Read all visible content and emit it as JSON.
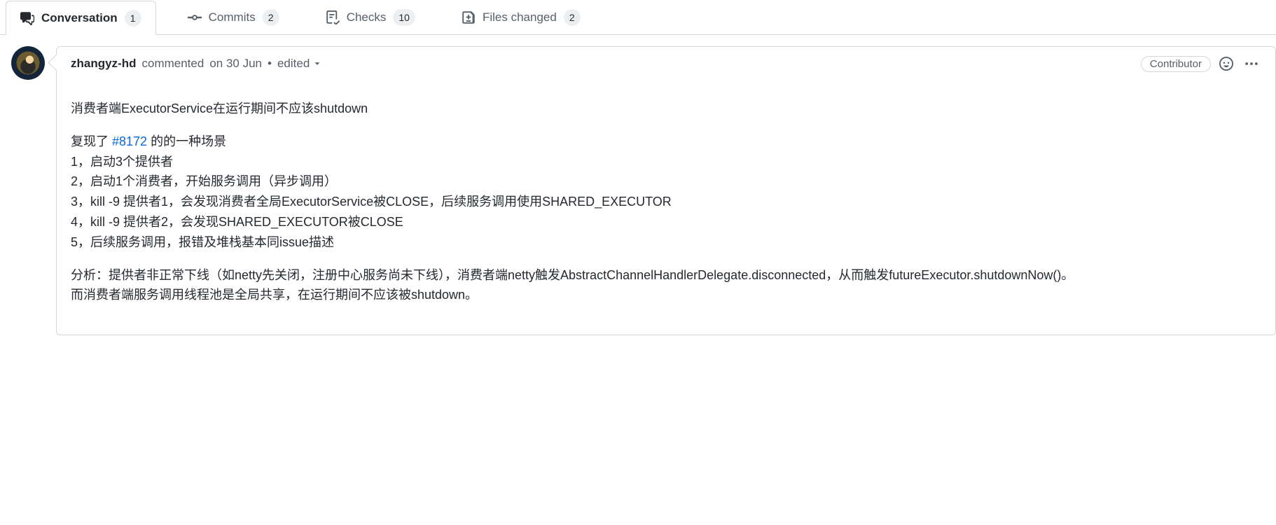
{
  "tabs": {
    "conversation": {
      "label": "Conversation",
      "count": "1"
    },
    "commits": {
      "label": "Commits",
      "count": "2"
    },
    "checks": {
      "label": "Checks",
      "count": "10"
    },
    "files": {
      "label": "Files changed",
      "count": "2"
    }
  },
  "comment": {
    "author": "zhangyz-hd",
    "action": "commented",
    "when_prefix": "on ",
    "when": "30 Jun",
    "sep": " • ",
    "edited": "edited",
    "badge": "Contributor",
    "body": {
      "p1": "消费者端ExecutorService在运行期间不应该shutdown",
      "p2_a": "复现了 ",
      "issue_ref": "#8172",
      "p2_b": " 的的一种场景",
      "l1": "1，启动3个提供者",
      "l2": "2，启动1个消费者，开始服务调用（异步调用）",
      "l3": "3，kill -9 提供者1，会发现消费者全局ExecutorService被CLOSE，后续服务调用使用SHARED_EXECUTOR",
      "l4": "4，kill -9 提供者2，会发现SHARED_EXECUTOR被CLOSE",
      "l5": "5，后续服务调用，报错及堆栈基本同issue描述",
      "p3a": "分析：提供者非正常下线（如netty先关闭，注册中心服务尚未下线），消费者端netty触发AbstractChannelHandlerDelegate.disconnected，从而触发futureExecutor.shutdownNow()。",
      "p3b": "而消费者端服务调用线程池是全局共享，在运行期间不应该被shutdown。"
    }
  }
}
